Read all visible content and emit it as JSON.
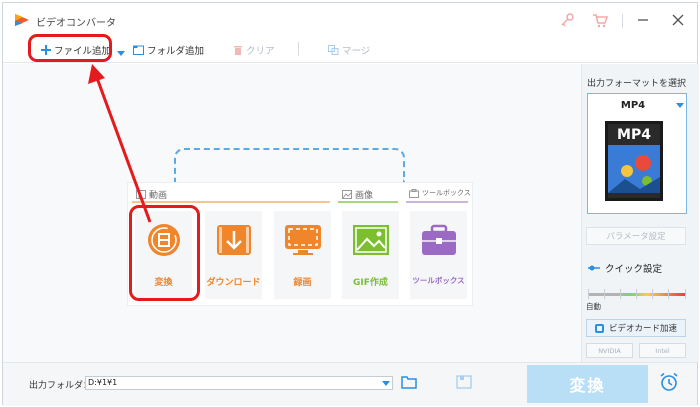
{
  "app": {
    "title": "ビデオコンバータ"
  },
  "toolbar": {
    "add_file": "ファイル追加",
    "add_folder": "フォルダ追加",
    "clear": "クリア",
    "merge": "マージ"
  },
  "sections": {
    "video": "動画",
    "image": "画像",
    "toolbox": "ツールボックス"
  },
  "tiles": [
    {
      "label": "変換",
      "color": "#f0862c"
    },
    {
      "label": "ダウンロード",
      "color": "#f0862c"
    },
    {
      "label": "録画",
      "color": "#f0862c"
    },
    {
      "label": "GIF作成",
      "color": "#7bbf2f"
    },
    {
      "label": "ツールボックス",
      "color": "#9b6ac4"
    }
  ],
  "right_panel": {
    "format_title": "出力フォーマットを選択",
    "format_name": "MP4",
    "format_image_text": "MP4",
    "param_button": "パラメータ設定",
    "quick_setting": "クイック設定",
    "slider_label": "自動",
    "gpu_button": "ビデオカード加速",
    "vendor_nvidia": "NVIDIA",
    "vendor_intel": "Intel"
  },
  "bottom": {
    "output_label": "出力フォルダ：",
    "output_path": "D:¥1¥1",
    "convert_button": "変換"
  },
  "colors": {
    "accent": "#2b8fe0",
    "annotation": "#e41a1c",
    "convert_disabled": "#b9dff7"
  }
}
